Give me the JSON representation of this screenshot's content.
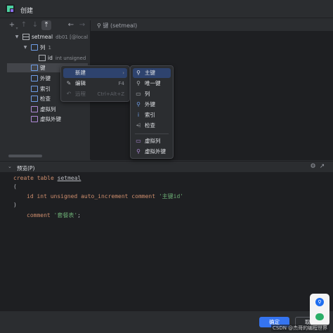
{
  "window": {
    "title": "创建"
  },
  "tree": {
    "rows": [
      {
        "label": "setmeal",
        "sub": "db01 [@localho",
        "icon": "table-icon"
      },
      {
        "label": "列",
        "sub": "1",
        "icon": "folder-icon"
      },
      {
        "label": "id",
        "sub": "int unsigned (au",
        "icon": "column-icon"
      },
      {
        "label": "键",
        "sub": "",
        "icon": "folder-icon"
      },
      {
        "label": "外键",
        "sub": "",
        "icon": "folder-icon"
      },
      {
        "label": "索引",
        "sub": "",
        "icon": "folder-icon"
      },
      {
        "label": "检查",
        "sub": "",
        "icon": "folder-icon"
      },
      {
        "label": "虚拟列",
        "sub": "",
        "icon": "folder-icon"
      },
      {
        "label": "虚拟外键",
        "sub": "",
        "icon": "folder-icon"
      }
    ]
  },
  "right_header": {
    "label": "键 (setmeal)"
  },
  "context_menu": {
    "items": [
      {
        "label": "新建",
        "shortcut": ""
      },
      {
        "label": "编辑",
        "shortcut": "F4"
      },
      {
        "label": "远程",
        "shortcut": "Ctrl+Alt+Z"
      }
    ]
  },
  "submenu": {
    "items": [
      {
        "label": "主键",
        "icon": "key-icon"
      },
      {
        "label": "唯一键",
        "icon": "key-outline-icon"
      },
      {
        "label": "列",
        "icon": "column-icon"
      },
      {
        "label": "外键",
        "icon": "foreign-key-icon"
      },
      {
        "label": "索引",
        "icon": "index-icon"
      },
      {
        "label": "检查",
        "icon": "check-icon"
      },
      {
        "label": "虚拟列",
        "icon": "virtual-column-icon"
      },
      {
        "label": "虚拟外键",
        "icon": "virtual-foreign-key-icon"
      }
    ]
  },
  "preview": {
    "label": "预览(P)",
    "code": {
      "l1_kw": "create table ",
      "l1_id": "setmeal",
      "l2": "(",
      "l3_a": "id int unsigned auto_increment comment ",
      "l3_str": "'主键id'",
      "l4": ")",
      "l5_a": "comment ",
      "l5_str": "'套餐表'",
      "l5_end": ";"
    }
  },
  "buttons": {
    "ok": "确定",
    "cancel": "取消"
  },
  "watermark": "CSDN @杰哥的编程世界",
  "colors": {
    "accent": "#3574f0",
    "background": "#2b2d30",
    "editor": "#1e1f22",
    "highlight": "#2e436e"
  }
}
